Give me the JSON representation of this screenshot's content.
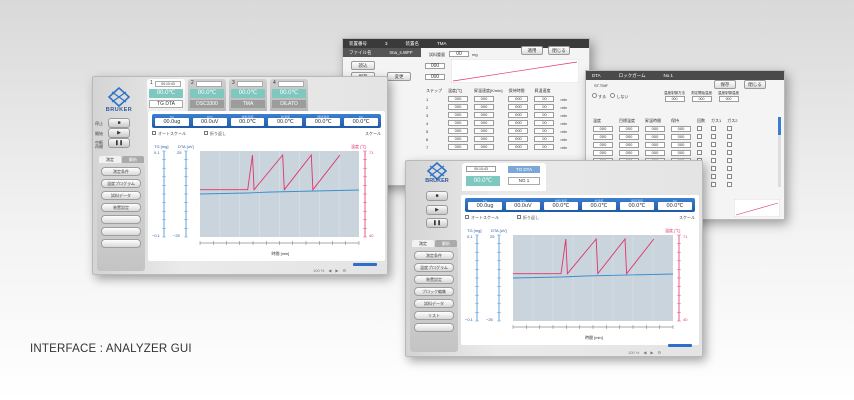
{
  "caption": "INTERFACE : ANALYZER GUI",
  "settings_window": {
    "header_fields": [
      "装置番号",
      "3",
      "装置名",
      "TMA",
      "ファイル名",
      "tma_s.WFF"
    ],
    "sample_weight_label": "試料重量",
    "sample_weight_value": "00",
    "sample_weight_unit": "mg",
    "buttons": [
      "読込",
      "保存",
      "変更",
      "適用",
      "閉じる"
    ],
    "value_cells": [
      "000",
      "000"
    ],
    "step_header": [
      "ステップ",
      "温度[℃]",
      "昇温速度[K/min]",
      "保持時間",
      "昇温速度"
    ],
    "step_rows": [
      [
        "1",
        "000",
        "000",
        "000",
        "00"
      ],
      [
        "2",
        "000",
        "000",
        "000",
        "00"
      ],
      [
        "3",
        "000",
        "000",
        "000",
        "00"
      ],
      [
        "4",
        "000",
        "000",
        "000",
        "00"
      ],
      [
        "5",
        "000",
        "000",
        "000",
        "00"
      ],
      [
        "6",
        "000",
        "000",
        "000",
        "00"
      ],
      [
        "7",
        "000",
        "000",
        "000",
        "00"
      ]
    ],
    "unit_min": "min"
  },
  "program_window": {
    "header_fields": [
      "DTA",
      "ロックガーム",
      "No.1"
    ],
    "file_label": "ST.TMF",
    "buttons": [
      "保存",
      "閉じる"
    ],
    "radio_labels": [
      "する",
      "しない"
    ],
    "top_headers": [
      "温度制御方法",
      "測定開始温度",
      "温度制御温度"
    ],
    "top_values": [
      "000",
      "000",
      "000"
    ],
    "col_headers": [
      "温度",
      "目標温度",
      "昇温時間",
      "保持",
      "回数",
      "ガス1",
      "ガス2"
    ],
    "rows": [
      [
        "000",
        "000",
        "000",
        "000"
      ],
      [
        "000",
        "000",
        "000",
        "000"
      ],
      [
        "000",
        "000",
        "000",
        "000"
      ],
      [
        "000",
        "000",
        "000",
        "000"
      ],
      [
        "000",
        "000",
        "000",
        "000"
      ],
      [
        "000",
        "000",
        "000",
        "000"
      ],
      [
        "000",
        "000",
        "000",
        "000"
      ],
      [
        "000",
        "000",
        "000",
        "000"
      ]
    ],
    "units": [
      "℃",
      "℃/min",
      "min",
      "℃",
      "min"
    ]
  },
  "left_window": {
    "logo_text": "BRUKER",
    "side_buttons": [
      {
        "label": "停止"
      },
      {
        "label": "開始"
      },
      {
        "label": "中断 再開"
      }
    ],
    "device_tabs": [
      {
        "num": "1",
        "time": "00:10:43",
        "temp": "00.0℃",
        "mode": "TG DTA",
        "active": true
      },
      {
        "num": "2",
        "time": "",
        "temp": "00.0℃",
        "mode": "DSC3300",
        "active": false
      },
      {
        "num": "3",
        "time": "",
        "temp": "00.0℃",
        "mode": "TMA",
        "active": false
      },
      {
        "num": "4",
        "time": "",
        "temp": "00.0℃",
        "mode": "DILATO",
        "active": false
      }
    ],
    "values": [
      {
        "cap": "TG",
        "v": "00.0ug"
      },
      {
        "cap": "DTA",
        "v": "00.0uV"
      },
      {
        "cap": "試料温度",
        "v": "00.0℃"
      },
      {
        "cap": "炉温度",
        "v": "00.0℃"
      },
      {
        "cap": "保持温度",
        "v": "00.0℃"
      },
      {
        "cap": "DC",
        "v": "00.0℃"
      }
    ],
    "options": [
      "オートスケール",
      "折り返し"
    ],
    "scale_label": "スケール",
    "ctl_tabs": [
      "測定",
      "解析"
    ],
    "ctl_buttons": [
      "測定条件",
      "温度プログラム",
      "試料データ",
      "装置設定"
    ],
    "chart_left_label_1": "TG [mg]",
    "chart_left_label_2": "DTA [uV]",
    "chart_right_label": "温度 [℃]",
    "chart_tick_top_1": "0.1",
    "chart_tick_bot_1": "−0.1",
    "chart_tick_top_2": "25",
    "chart_tick_bot_2": "−25",
    "chart_tick_top_r": "71",
    "chart_tick_bot_r": "40",
    "chart_xlabel": "時間 [min]",
    "footer": "100 %"
  },
  "right_window": {
    "logo_text": "BRUKER",
    "device_tab": {
      "time": "00:10:43",
      "temp": "00.0℃",
      "mode": "TG DTA",
      "sample": "NG 1"
    },
    "values": [
      {
        "cap": "TG",
        "v": "00.0ug"
      },
      {
        "cap": "DTA",
        "v": "00.0uV"
      },
      {
        "cap": "試料温度",
        "v": "00.0℃"
      },
      {
        "cap": "炉温度",
        "v": "00.0℃"
      },
      {
        "cap": "保持温度",
        "v": "00.0℃"
      },
      {
        "cap": "DC",
        "v": "00.0℃"
      }
    ],
    "options": [
      "オートスケール",
      "折り返し"
    ],
    "scale_label": "スケール",
    "ctl_tabs": [
      "測定",
      "解析"
    ],
    "ctl_buttons": [
      "測定条件",
      "温度プログラム",
      "装置設定",
      "ブロック編集",
      "試料データ",
      "リスト"
    ],
    "chart_left_label_1": "TG [mg]",
    "chart_left_label_2": "DTA [uV]",
    "chart_right_label": "温度 [℃]",
    "chart_tick_top_1": "0.1",
    "chart_tick_bot_1": "−0.1",
    "chart_tick_top_2": "25",
    "chart_tick_bot_2": "−25",
    "chart_tick_top_r": "71",
    "chart_tick_bot_r": "40",
    "chart_xlabel": "時間 [min]",
    "footer": "100 %"
  },
  "colors": {
    "accent_blue": "#2f6fc7",
    "temp_teal": "#7fc8c0",
    "curve_red": "#e0336b",
    "curve_blue": "#3c8fd0",
    "plot_bg": "#c9d4dc"
  }
}
